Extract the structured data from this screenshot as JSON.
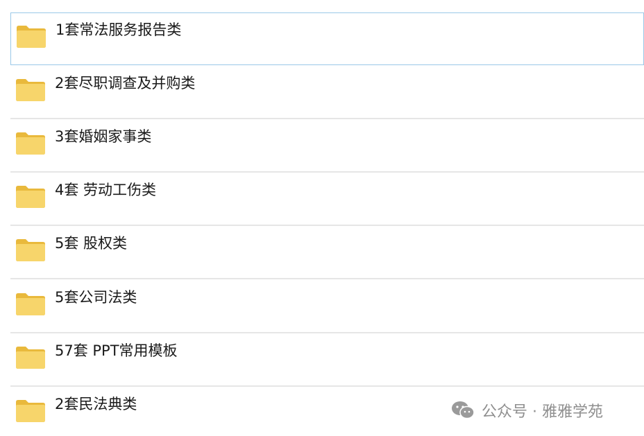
{
  "folders": [
    {
      "label": "1套常法服务报告类",
      "icon": "folder-icon"
    },
    {
      "label": "2套尽职调查及并购类",
      "icon": "folder-icon"
    },
    {
      "label": "3套婚姻家事类",
      "icon": "folder-icon"
    },
    {
      "label": "4套 劳动工伤类",
      "icon": "folder-icon"
    },
    {
      "label": "5套 股权类",
      "icon": "folder-icon"
    },
    {
      "label": "5套公司法类",
      "icon": "folder-icon"
    },
    {
      "label": "57套 PPT常用模板",
      "icon": "folder-icon"
    },
    {
      "label": "2套民法典类",
      "icon": "folder-icon"
    }
  ],
  "selected_index": 0,
  "watermark": {
    "text": "公众号 · 雅雅学苑",
    "icon": "wechat-icon"
  },
  "colors": {
    "folder_body": "#f7d56b",
    "folder_back": "#e9b93c",
    "selection_border": "#9ac8e8",
    "divider": "#e6e6e6"
  }
}
